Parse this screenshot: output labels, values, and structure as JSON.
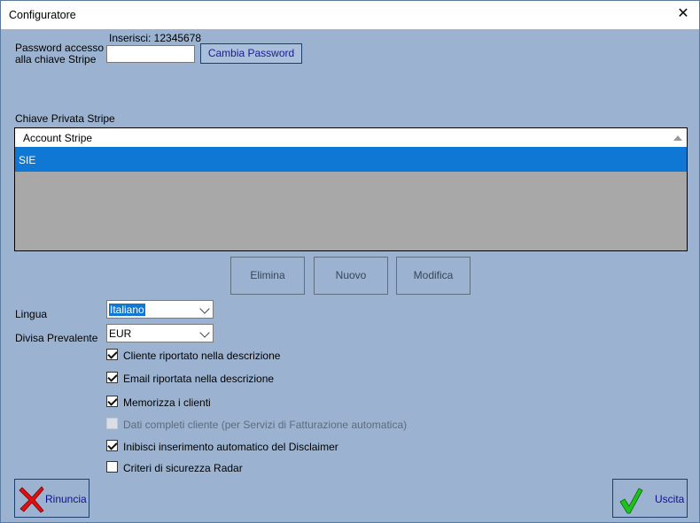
{
  "window": {
    "title": "Configuratore",
    "close_glyph": "✕"
  },
  "password": {
    "label_line1": "Password accesso",
    "label_line2": "alla chiave Stripe",
    "hint": "Inserisci: 12345678",
    "value": "",
    "change_button": "Cambia Password"
  },
  "stripe": {
    "section_label": "Chiave Privata Stripe",
    "column_header": "Account Stripe",
    "rows": [
      "SIE"
    ],
    "buttons": {
      "delete": "Elimina",
      "new": "Nuovo",
      "edit": "Modifica"
    }
  },
  "language": {
    "label": "Lingua",
    "value": "Italiano"
  },
  "currency": {
    "label": "Divisa Prevalente",
    "value": "EUR"
  },
  "options": [
    {
      "label": "Cliente riportato nella descrizione",
      "checked": true,
      "enabled": true
    },
    {
      "label": "Email riportata nella descrizione",
      "checked": true,
      "enabled": true
    },
    {
      "label": "Memorizza i clienti",
      "checked": true,
      "enabled": true
    },
    {
      "label": "Dati completi cliente (per Servizi di Fatturazione automatica)",
      "checked": false,
      "enabled": false
    },
    {
      "label": "Inibisci inserimento automatico del Disclaimer",
      "checked": true,
      "enabled": true
    },
    {
      "label": "Criteri di sicurezza Radar",
      "checked": false,
      "enabled": true
    }
  ],
  "footer": {
    "cancel_label": "Rinuncia",
    "exit_label": "Uscita",
    "cancel_icon": "red-x-icon",
    "exit_icon": "green-check-icon",
    "colors": {
      "cancel_icon": "#e01010",
      "exit_icon": "#1ec21e"
    }
  }
}
